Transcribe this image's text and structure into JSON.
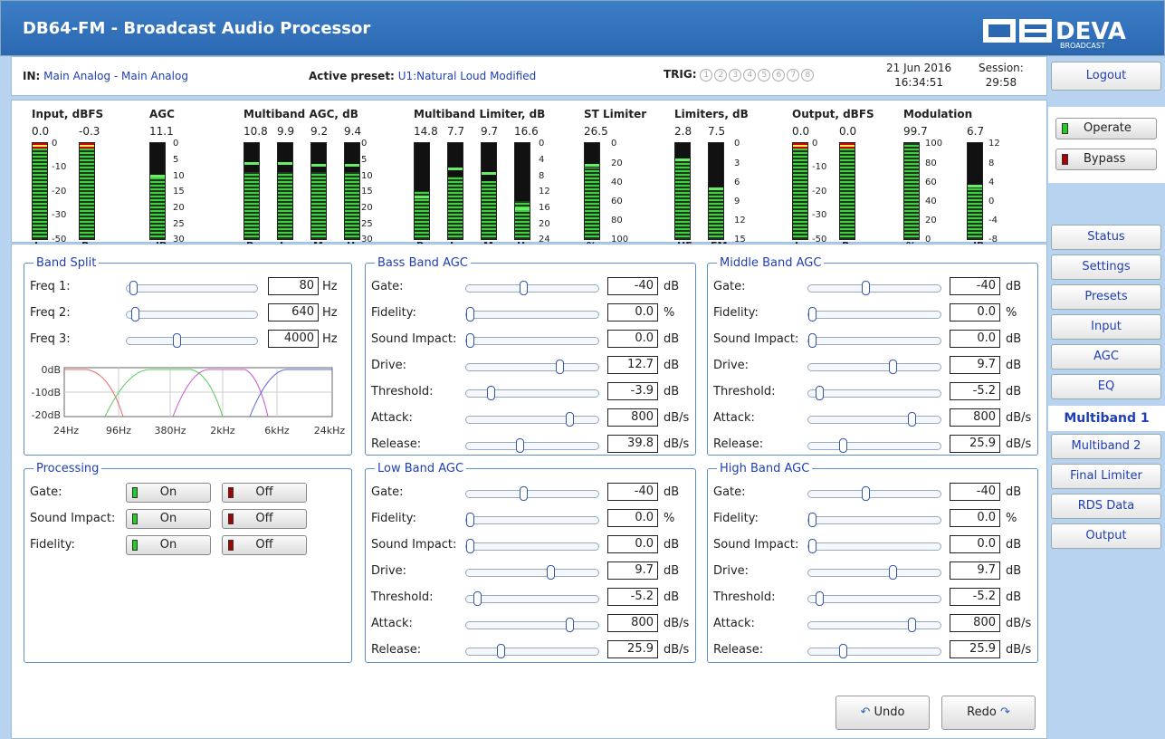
{
  "app": {
    "title": "DB64-FM - Broadcast Audio Processor",
    "logo_text": "DEVA",
    "logo_sub": "BROADCAST"
  },
  "info": {
    "in_label": "IN:",
    "in_value": "Main Analog - Main Analog",
    "preset_label": "Active preset:",
    "preset_value": "U1:Natural Loud Modified",
    "trig_label": "TRIG:",
    "trig_items": [
      "1",
      "2",
      "3",
      "4",
      "5",
      "6",
      "7",
      "8"
    ],
    "date": "21 Jun 2016",
    "time": "16:34:51",
    "session_label": "Session:",
    "session_value": "29:58"
  },
  "side": {
    "logout": "Logout",
    "operate": "Operate",
    "bypass": "Bypass",
    "nav": [
      "Status",
      "Settings",
      "Presets",
      "Input",
      "AGC",
      "EQ",
      "Multiband 1",
      "Multiband 2",
      "Final Limiter",
      "RDS Data",
      "Output"
    ],
    "active": "Multiband 1"
  },
  "meters": {
    "input": {
      "title": "Input, dBFS",
      "values": [
        "0.0",
        "-0.3"
      ],
      "labels": [
        "L",
        "R"
      ],
      "scale": [
        "0",
        "-10",
        "-20",
        "-30",
        "-50"
      ]
    },
    "agc": {
      "title": "AGC",
      "value": "11.1",
      "label": "dB",
      "scale": [
        "0",
        "5",
        "10",
        "15",
        "20",
        "25",
        "30"
      ]
    },
    "mb_agc": {
      "title": "Multiband AGC, dB",
      "values": [
        "10.8",
        "9.9",
        "9.2",
        "9.4"
      ],
      "labels": [
        "B",
        "L",
        "M",
        "H"
      ],
      "scale": [
        "0",
        "5",
        "10",
        "15",
        "20",
        "25",
        "30"
      ]
    },
    "mb_lim": {
      "title": "Multiband Limiter, dB",
      "values": [
        "14.8",
        "7.7",
        "9.7",
        "16.6"
      ],
      "labels": [
        "B",
        "L",
        "M",
        "H"
      ],
      "scale": [
        "0",
        "4",
        "8",
        "12",
        "16",
        "20",
        "24"
      ]
    },
    "st_lim": {
      "title": "ST Limiter",
      "value": "26.5",
      "label": "%",
      "scale": [
        "0",
        "20",
        "40",
        "60",
        "80",
        "100"
      ]
    },
    "limiters": {
      "title": "Limiters, dB",
      "values": [
        "2.8",
        "7.5"
      ],
      "labels": [
        "HF",
        "FM"
      ],
      "scale": [
        "0",
        "3",
        "6",
        "9",
        "12",
        "15"
      ]
    },
    "output": {
      "title": "Output, dBFS",
      "values": [
        "0.0",
        "0.0"
      ],
      "labels": [
        "L",
        "R"
      ],
      "scale": [
        "0",
        "-10",
        "-20",
        "-30",
        "-50"
      ]
    },
    "modulation": {
      "title": "Modulation",
      "values": [
        "99.7",
        "6.7"
      ],
      "labels": [
        "%",
        "dBr"
      ],
      "scale_pct": [
        "100",
        "80",
        "60",
        "40",
        "20",
        "0"
      ],
      "scale_dbr": [
        "12",
        "8",
        "4",
        "0",
        "-4",
        "-8"
      ]
    }
  },
  "band_split": {
    "title": "Band Split",
    "rows": [
      {
        "label": "Freq 1:",
        "value": "80",
        "unit": "Hz",
        "pos": 0.02
      },
      {
        "label": "Freq 2:",
        "value": "640",
        "unit": "Hz",
        "pos": 0.04
      },
      {
        "label": "Freq 3:",
        "value": "4000",
        "unit": "Hz",
        "pos": 0.38
      }
    ],
    "graph": {
      "y_labels": [
        "0dB",
        "-10dB",
        "-20dB"
      ],
      "x_labels": [
        "24Hz",
        "96Hz",
        "380Hz",
        "2kHz",
        "6kHz",
        "24kHz"
      ]
    }
  },
  "processing": {
    "title": "Processing",
    "rows": [
      {
        "label": "Gate:",
        "on": "On",
        "off": "Off"
      },
      {
        "label": "Sound Impact:",
        "on": "On",
        "off": "Off"
      },
      {
        "label": "Fidelity:",
        "on": "On",
        "off": "Off"
      }
    ]
  },
  "bass": {
    "title": "Bass Band AGC",
    "rows": [
      {
        "label": "Gate:",
        "value": "-40",
        "unit": "dB",
        "pos": 0.43
      },
      {
        "label": "Fidelity:",
        "value": "0.0",
        "unit": "%",
        "pos": 0.0
      },
      {
        "label": "Sound Impact:",
        "value": "0.0",
        "unit": "dB",
        "pos": 0.0
      },
      {
        "label": "Drive:",
        "value": "12.7",
        "unit": "dB",
        "pos": 0.72
      },
      {
        "label": "Threshold:",
        "value": "-3.9",
        "unit": "dB",
        "pos": 0.17
      },
      {
        "label": "Attack:",
        "value": "800",
        "unit": "dB/s",
        "pos": 0.8
      },
      {
        "label": "Release:",
        "value": "39.8",
        "unit": "dB/s",
        "pos": 0.4
      }
    ]
  },
  "middle": {
    "title": "Middle Band AGC",
    "rows": [
      {
        "label": "Gate:",
        "value": "-40",
        "unit": "dB",
        "pos": 0.43
      },
      {
        "label": "Fidelity:",
        "value": "0.0",
        "unit": "%",
        "pos": 0.0
      },
      {
        "label": "Sound Impact:",
        "value": "0.0",
        "unit": "dB",
        "pos": 0.0
      },
      {
        "label": "Drive:",
        "value": "9.7",
        "unit": "dB",
        "pos": 0.65
      },
      {
        "label": "Threshold:",
        "value": "-5.2",
        "unit": "dB",
        "pos": 0.06
      },
      {
        "label": "Attack:",
        "value": "800",
        "unit": "dB/s",
        "pos": 0.8
      },
      {
        "label": "Release:",
        "value": "25.9",
        "unit": "dB/s",
        "pos": 0.25
      }
    ]
  },
  "low": {
    "title": "Low Band AGC",
    "rows": [
      {
        "label": "Gate:",
        "value": "-40",
        "unit": "dB",
        "pos": 0.43
      },
      {
        "label": "Fidelity:",
        "value": "0.0",
        "unit": "%",
        "pos": 0.0
      },
      {
        "label": "Sound Impact:",
        "value": "0.0",
        "unit": "dB",
        "pos": 0.0
      },
      {
        "label": "Drive:",
        "value": "9.7",
        "unit": "dB",
        "pos": 0.65
      },
      {
        "label": "Threshold:",
        "value": "-5.2",
        "unit": "dB",
        "pos": 0.06
      },
      {
        "label": "Attack:",
        "value": "800",
        "unit": "dB/s",
        "pos": 0.8
      },
      {
        "label": "Release:",
        "value": "25.9",
        "unit": "dB/s",
        "pos": 0.25
      }
    ]
  },
  "high": {
    "title": "High Band AGC",
    "rows": [
      {
        "label": "Gate:",
        "value": "-40",
        "unit": "dB",
        "pos": 0.43
      },
      {
        "label": "Fidelity:",
        "value": "0.0",
        "unit": "%",
        "pos": 0.0
      },
      {
        "label": "Sound Impact:",
        "value": "0.0",
        "unit": "dB",
        "pos": 0.0
      },
      {
        "label": "Drive:",
        "value": "9.7",
        "unit": "dB",
        "pos": 0.65
      },
      {
        "label": "Threshold:",
        "value": "-5.2",
        "unit": "dB",
        "pos": 0.06
      },
      {
        "label": "Attack:",
        "value": "800",
        "unit": "dB/s",
        "pos": 0.8
      },
      {
        "label": "Release:",
        "value": "25.9",
        "unit": "dB/s",
        "pos": 0.25
      }
    ]
  },
  "footer": {
    "undo": "Undo",
    "redo": "Redo"
  },
  "colors": {
    "accent": "#2b68b1",
    "link": "#1f3fb3",
    "on": "#2c2",
    "off": "#a00"
  }
}
